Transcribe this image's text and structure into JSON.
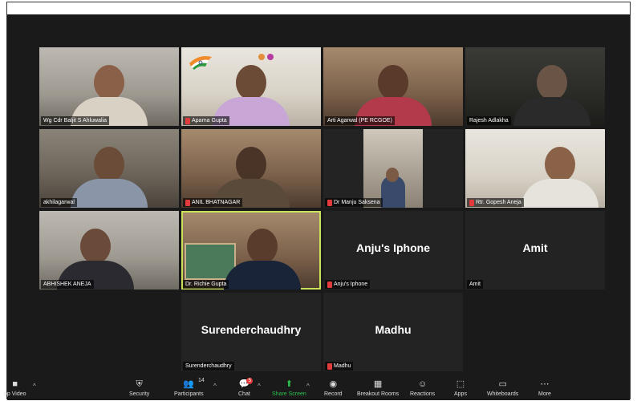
{
  "participants": [
    {
      "name": "Wg Cdr Baljit S Ahluwalia",
      "muted": false
    },
    {
      "name": "Aparna Gupta",
      "muted": true
    },
    {
      "name": "Arti Agarwal (PE RCGOE)",
      "muted": false
    },
    {
      "name": "Rajesh Adlakha",
      "muted": false
    },
    {
      "name": "akhilagarwal",
      "muted": false
    },
    {
      "name": "ANIL BHATNAGAR",
      "muted": true
    },
    {
      "name": "Dr Manju Saksena",
      "muted": true
    },
    {
      "name": "Rtr. Gopesh Aneja",
      "muted": true
    },
    {
      "name": "ABHISHEK ANEJA",
      "muted": false
    },
    {
      "name": "Dr. Richie Gupta",
      "muted": false
    },
    {
      "name": "Anju's Iphone",
      "display": "Anju's Iphone",
      "muted": true
    },
    {
      "name": "Amit",
      "display": "Amit",
      "muted": false
    },
    {
      "name": "Surenderchaudhry",
      "display": "Surenderchaudhry",
      "muted": false
    },
    {
      "name": "Madhu",
      "display": "Madhu",
      "muted": true
    }
  ],
  "toolbar": {
    "video": "op Video",
    "security": "Security",
    "participants": "Participants",
    "participants_count": "14",
    "chat": "Chat",
    "chat_badge": "5",
    "share": "Share Screen",
    "record": "Record",
    "breakout": "Breakout Rooms",
    "reactions": "Reactions",
    "apps": "Apps",
    "whiteboards": "Whiteboards",
    "more": "More"
  },
  "colors": {
    "active_speaker": "#c9e25a",
    "share_green": "#2bc04a",
    "muted_red": "#e23b3b"
  }
}
